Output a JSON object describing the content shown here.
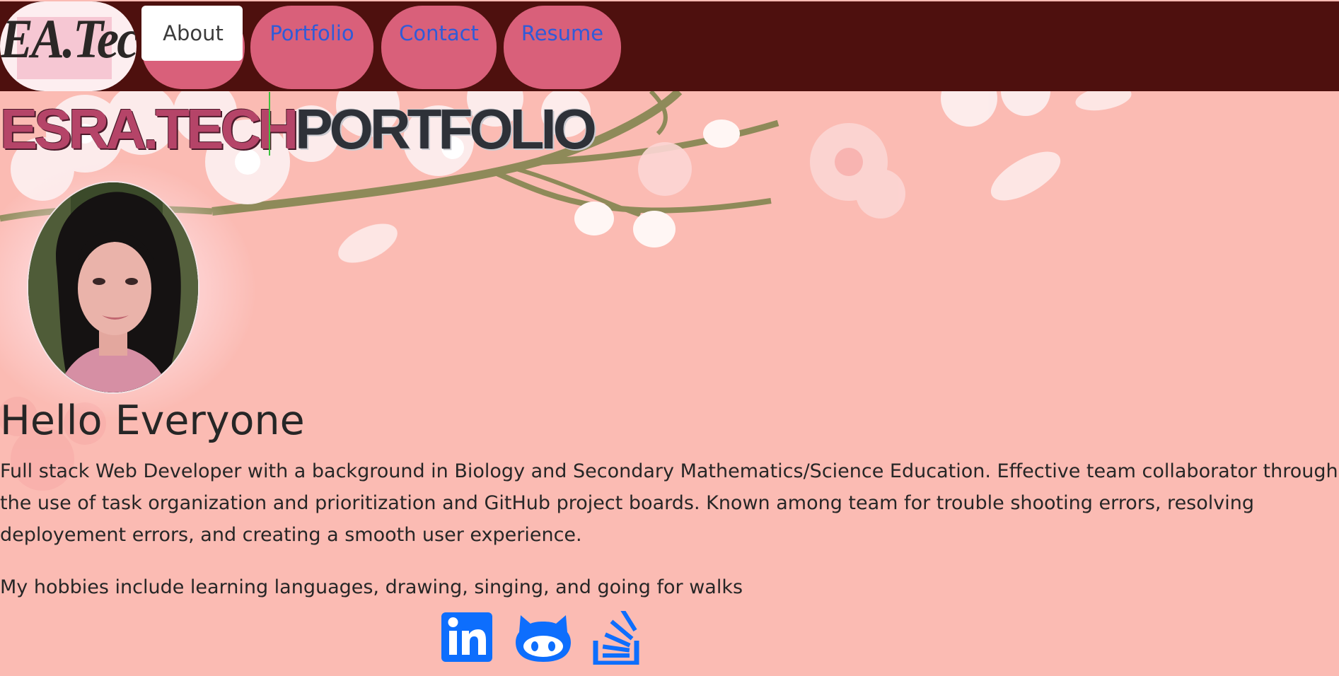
{
  "navbar": {
    "brand": "EA.Tech",
    "items": [
      {
        "label": "About",
        "active": true
      },
      {
        "label": "Portfolio",
        "active": false
      },
      {
        "label": "Contact",
        "active": false
      },
      {
        "label": "Resume",
        "active": false
      }
    ]
  },
  "hero": {
    "title_part1": "ESRA.TECH",
    "title_part2": "PORTFOLIO"
  },
  "about": {
    "heading": "Hello Everyone",
    "bio": "Full stack Web Developer with a background in Biology and Secondary Mathematics/Science Education. Effective team collaborator through the use of task organization and prioritization and GitHub project boards. Known among team for trouble shooting errors, resolving deployement errors, and creating a smooth user experience.",
    "hobbies": "My hobbies include learning languages, drawing, singing, and going for walks"
  },
  "social": [
    {
      "icon": "linkedin-icon"
    },
    {
      "icon": "github-icon"
    },
    {
      "icon": "stackoverflow-icon"
    }
  ],
  "colors": {
    "navbar_bg": "#4e100e",
    "nav_pill": "#d9607a",
    "nav_link": "#2f5bd8",
    "page_bg": "#fbbbb3",
    "hero_accent": "#b54468",
    "hero_dark": "#2e3138",
    "icon_blue": "#0d6efd"
  }
}
